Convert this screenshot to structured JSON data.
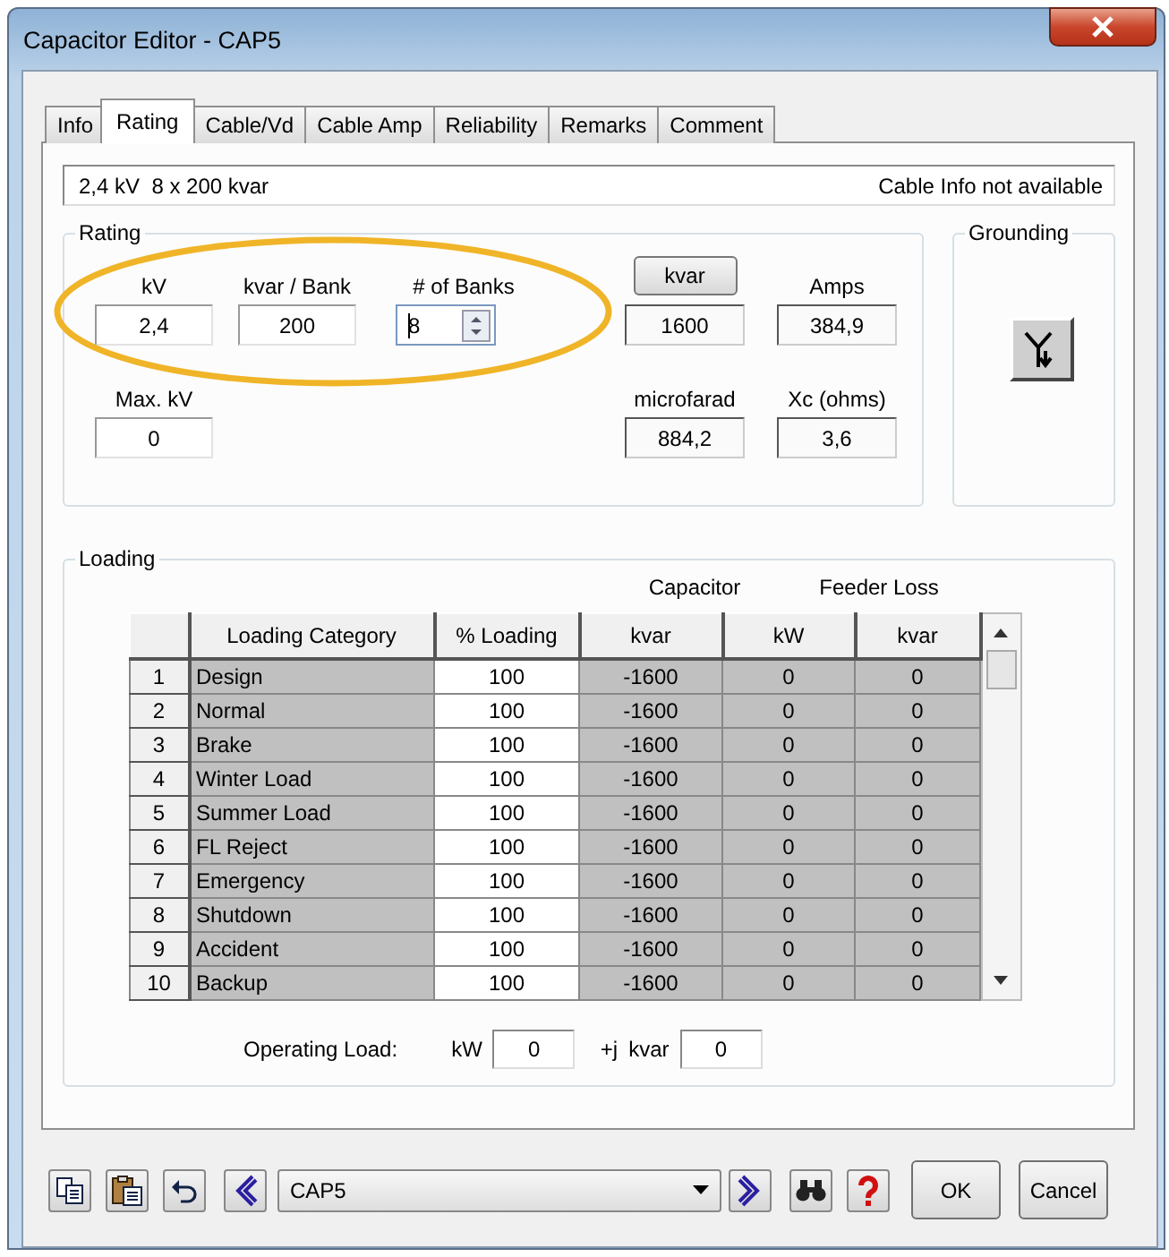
{
  "window": {
    "title": "Capacitor Editor - CAP5"
  },
  "tabs": [
    {
      "label": "Info",
      "selected": false
    },
    {
      "label": "Rating",
      "selected": true
    },
    {
      "label": "Cable/Vd",
      "selected": false
    },
    {
      "label": "Cable Amp",
      "selected": false
    },
    {
      "label": "Reliability",
      "selected": false
    },
    {
      "label": "Remarks",
      "selected": false
    },
    {
      "label": "Comment",
      "selected": false
    }
  ],
  "summary": {
    "rating": "2,4 kV  8 x 200 kvar",
    "cable_info": "Cable Info not available"
  },
  "rating": {
    "title": "Rating",
    "fields": [
      {
        "label": "kV",
        "value": "2,4",
        "kind": "text"
      },
      {
        "label": "kvar / Bank",
        "value": "200",
        "kind": "text"
      },
      {
        "label": "# of Banks",
        "value": "8",
        "kind": "spinner"
      },
      {
        "label": "Max. kV",
        "value": "0",
        "kind": "text"
      }
    ],
    "kvar_button": "kvar",
    "kvar": "1600",
    "amps_label": "Amps",
    "amps": "384,9",
    "microfarad_label": "microfarad",
    "microfarad": "884,2",
    "xc_label": "Xc (ohms)",
    "xc": "3,6"
  },
  "grounding": {
    "title": "Grounding"
  },
  "loading": {
    "title": "Loading",
    "group_headers": [
      "Capacitor",
      "Feeder Loss"
    ],
    "columns": [
      "Loading Category",
      "% Loading",
      "kvar",
      "kW",
      "kvar"
    ],
    "rows": [
      {
        "index": "1",
        "cells": [
          "Design",
          "100",
          "-1600",
          "0",
          "0"
        ]
      },
      {
        "index": "2",
        "cells": [
          "Normal",
          "100",
          "-1600",
          "0",
          "0"
        ]
      },
      {
        "index": "3",
        "cells": [
          "Brake",
          "100",
          "-1600",
          "0",
          "0"
        ]
      },
      {
        "index": "4",
        "cells": [
          "Winter Load",
          "100",
          "-1600",
          "0",
          "0"
        ]
      },
      {
        "index": "5",
        "cells": [
          "Summer Load",
          "100",
          "-1600",
          "0",
          "0"
        ]
      },
      {
        "index": "6",
        "cells": [
          "FL Reject",
          "100",
          "-1600",
          "0",
          "0"
        ]
      },
      {
        "index": "7",
        "cells": [
          "Emergency",
          "100",
          "-1600",
          "0",
          "0"
        ]
      },
      {
        "index": "8",
        "cells": [
          "Shutdown",
          "100",
          "-1600",
          "0",
          "0"
        ]
      },
      {
        "index": "9",
        "cells": [
          "Accident",
          "100",
          "-1600",
          "0",
          "0"
        ]
      },
      {
        "index": "10",
        "cells": [
          "Backup",
          "100",
          "-1600",
          "0",
          "0"
        ]
      }
    ]
  },
  "operating_load": {
    "label": "Operating Load:",
    "kw_label": "kW",
    "kw": "0",
    "j_label": "+j",
    "kvar_label": "kvar",
    "kvar": "0"
  },
  "footer": {
    "device": "CAP5",
    "ok": "OK",
    "cancel": "Cancel"
  }
}
